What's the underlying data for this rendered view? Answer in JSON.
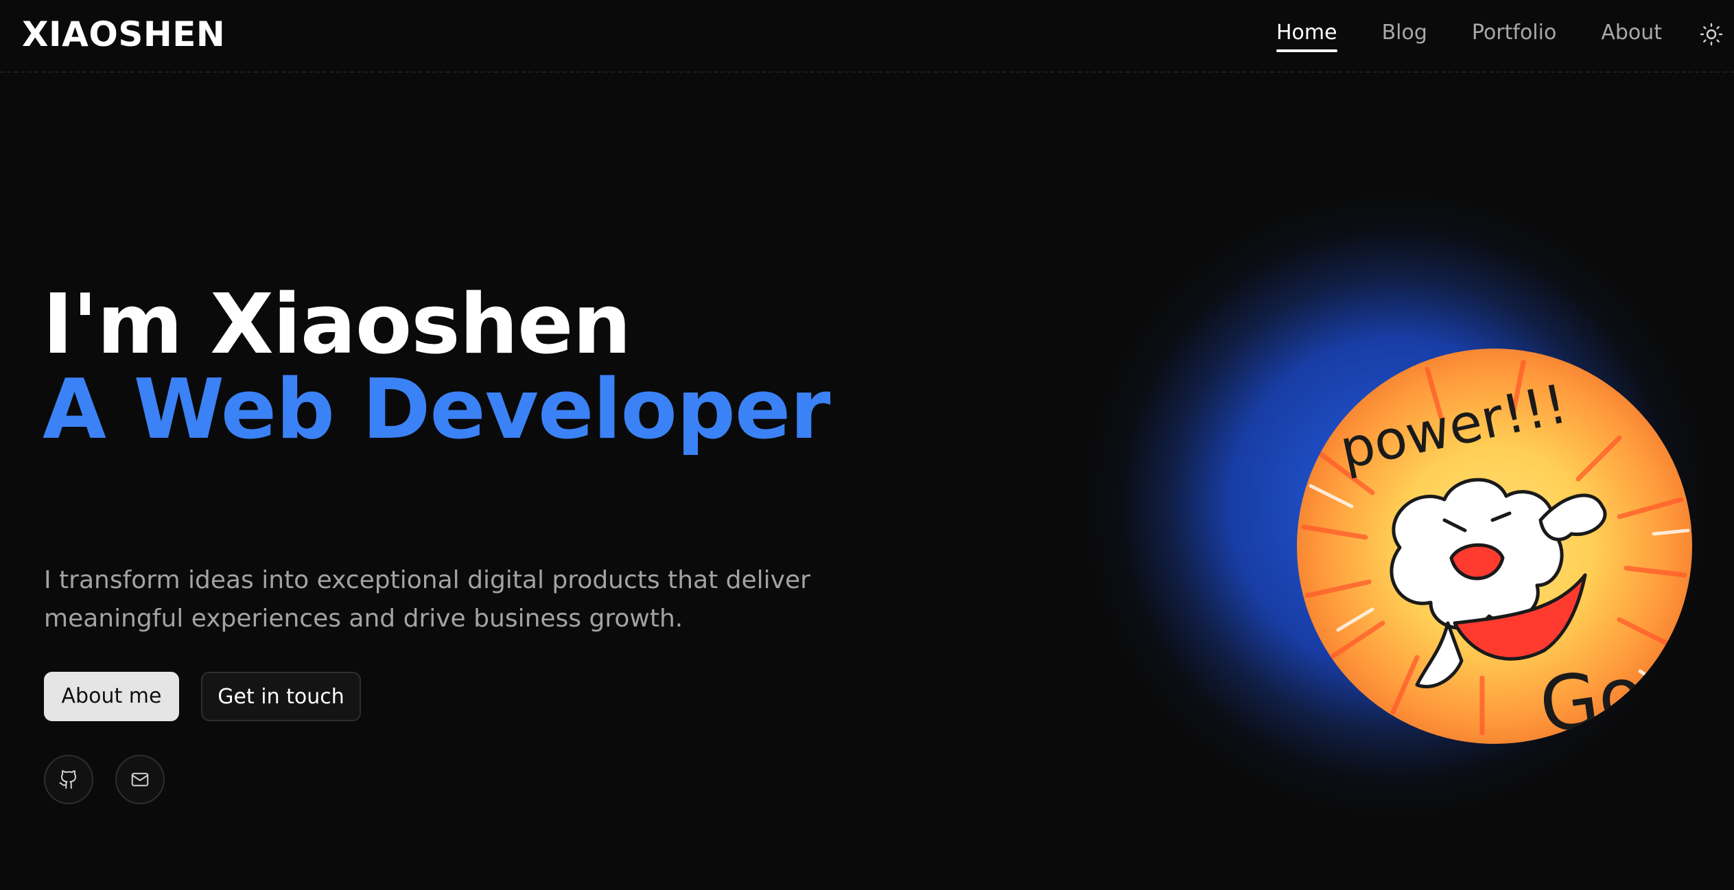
{
  "header": {
    "logo": "XIAOSHEN",
    "nav": [
      {
        "label": "Home",
        "active": true
      },
      {
        "label": "Blog",
        "active": false
      },
      {
        "label": "Portfolio",
        "active": false
      },
      {
        "label": "About",
        "active": false
      }
    ],
    "theme_toggle_icon": "sun-icon"
  },
  "hero": {
    "title_line1": "I'm Xiaoshen",
    "title_line2": "A Web Developer",
    "description": "I transform ideas into exceptional digital products that deliver meaningful experiences and drive business growth.",
    "primary_button": "About me",
    "secondary_button": "Get in touch",
    "social_icons": [
      "github-icon",
      "mail-icon"
    ]
  },
  "avatar": {
    "image_text": "power!!!",
    "image_text_partial": "Go"
  },
  "colors": {
    "background": "#0a0a0a",
    "accent": "#3b82f6",
    "muted_text": "#a3a3a3"
  }
}
